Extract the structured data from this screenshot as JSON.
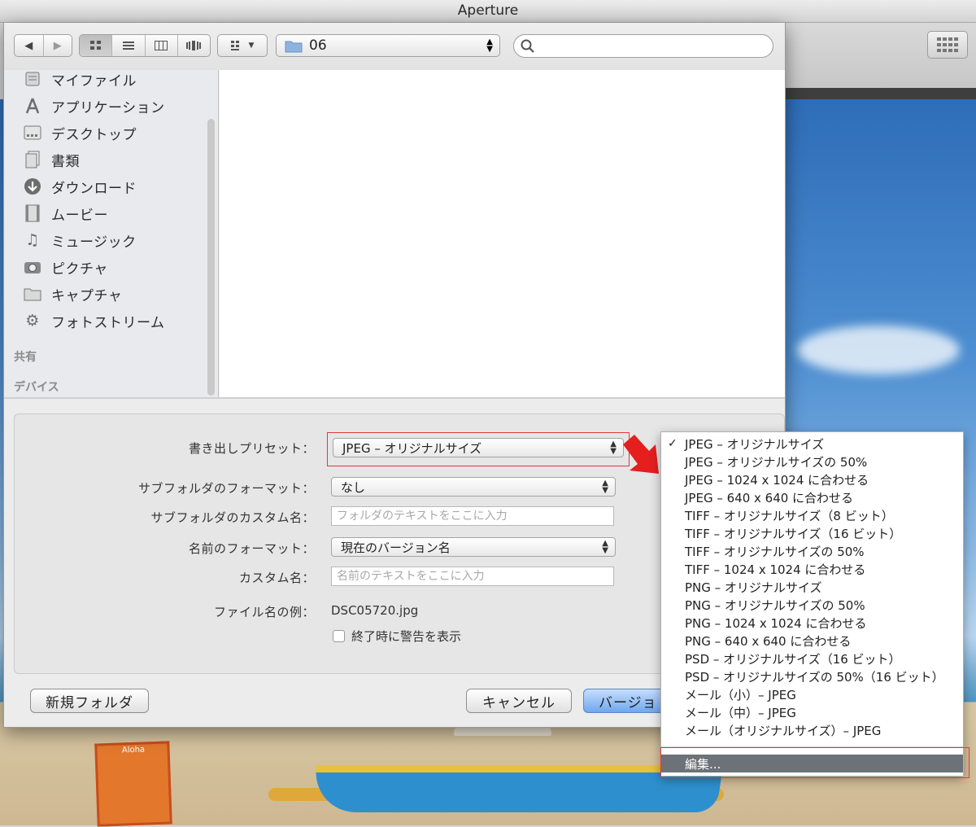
{
  "app": {
    "title": "Aperture"
  },
  "toolbar": {
    "path_folder": "06",
    "search_placeholder": ""
  },
  "sidebar": {
    "items": [
      {
        "label": "マイファイル",
        "icon": "all-my-files-icon"
      },
      {
        "label": "アプリケーション",
        "icon": "applications-icon"
      },
      {
        "label": "デスクトップ",
        "icon": "desktop-icon"
      },
      {
        "label": "書類",
        "icon": "documents-icon"
      },
      {
        "label": "ダウンロード",
        "icon": "downloads-icon"
      },
      {
        "label": "ムービー",
        "icon": "movies-icon"
      },
      {
        "label": "ミュージック",
        "icon": "music-icon"
      },
      {
        "label": "ピクチャ",
        "icon": "pictures-icon"
      },
      {
        "label": "キャプチャ",
        "icon": "folder-icon"
      },
      {
        "label": "フォトストリーム",
        "icon": "gear-icon"
      }
    ],
    "sections": {
      "shared": "共有",
      "devices": "デバイス"
    }
  },
  "options": {
    "preset_label": "書き出しプリセット：",
    "preset_value": "JPEG – オリジナルサイズ",
    "subfolder_format_label": "サブフォルダのフォーマット：",
    "subfolder_format_value": "なし",
    "subfolder_custom_label": "サブフォルダのカスタム名：",
    "subfolder_custom_placeholder": "フォルダのテキストをここに入力",
    "name_format_label": "名前のフォーマット：",
    "name_format_value": "現在のバージョン名",
    "custom_name_label": "カスタム名：",
    "custom_name_placeholder": "名前のテキストをここに入力",
    "filename_example_label": "ファイル名の例：",
    "filename_example_value": "DSC05720.jpg",
    "warn_on_finish_label": "終了時に警告を表示"
  },
  "buttons": {
    "new_folder": "新規フォルダ",
    "cancel": "キャンセル",
    "export_partial": "バージョ"
  },
  "preset_menu": {
    "selected_index": 0,
    "items": [
      "JPEG – オリジナルサイズ",
      "JPEG – オリジナルサイズの 50%",
      "JPEG – 1024 x 1024 に合わせる",
      "JPEG – 640 x 640 に合わせる",
      "TIFF – オリジナルサイズ（8 ビット）",
      "TIFF – オリジナルサイズ（16 ビット）",
      "TIFF – オリジナルサイズの 50%",
      "TIFF – 1024 x 1024 に合わせる",
      "PNG – オリジナルサイズ",
      "PNG – オリジナルサイズの 50%",
      "PNG – 1024 x 1024 に合わせる",
      "PNG – 640 x 640 に合わせる",
      "PSD – オリジナルサイズ（16 ビット）",
      "PSD – オリジナルサイズの 50%（16 ビット）",
      "メール（小）– JPEG",
      "メール（中）– JPEG",
      "メール（オリジナルサイズ）– JPEG"
    ],
    "edit_label": "編集..."
  },
  "background": {
    "sign_title": "Aloha"
  },
  "colors": {
    "highlight_red": "#e03a3a",
    "primary_button": "#6fa7ef",
    "menu_selected": "#6d7178"
  }
}
